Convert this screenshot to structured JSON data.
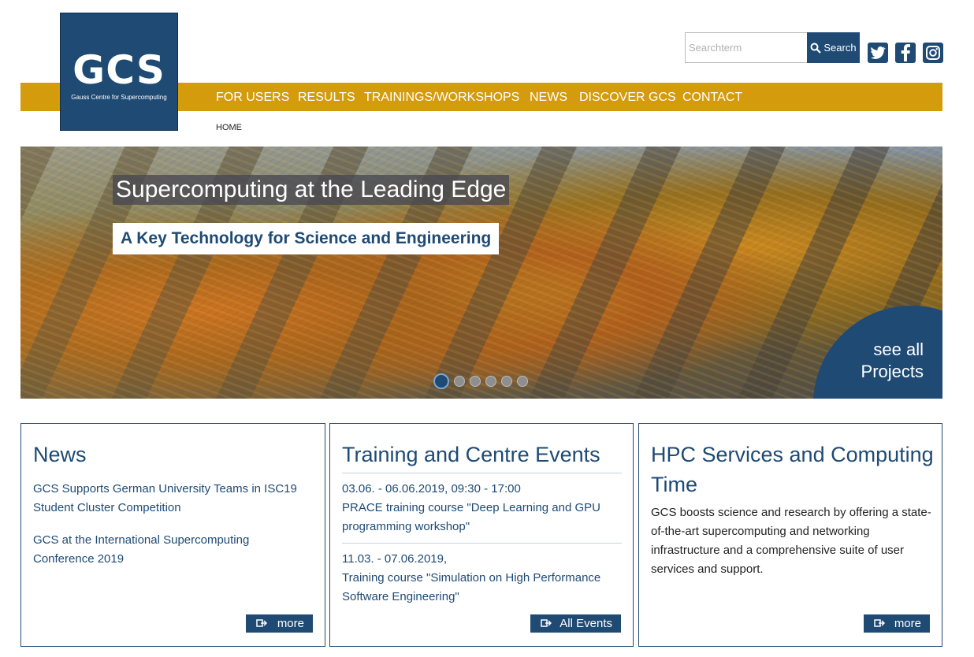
{
  "logo": {
    "text": "GCS",
    "subtitle": "Gauss Centre for Supercomputing"
  },
  "search": {
    "placeholder": "Searchterm",
    "button_label": "Search"
  },
  "social": [
    "twitter-icon",
    "facebook-icon",
    "instagram-icon"
  ],
  "nav": {
    "items": [
      "FOR USERS",
      "RESULTS",
      "TRAININGS/WORKSHOPS",
      "NEWS",
      "DISCOVER GCS",
      "CONTACT"
    ]
  },
  "breadcrumb": "HOME",
  "hero": {
    "title": "Supercomputing at the Leading Edge",
    "subtitle": "A Key Technology for Science and Engineering",
    "projects_line1": "see all",
    "projects_line2": "Projects",
    "slides": 6,
    "active_slide": 1
  },
  "news": {
    "heading": "News",
    "items": [
      "GCS Supports German University Teams in ISC19 Student Cluster Competition",
      "GCS at the International Supercomputing Conference 2019"
    ],
    "button": "more"
  },
  "events": {
    "heading": "Training and Centre Events",
    "items": [
      {
        "date": "03.06. - 06.06.2019, 09:30 - 17:00",
        "title": "PRACE training course \"Deep Learning and GPU programming workshop\""
      },
      {
        "date": "11.03. - 07.06.2019,",
        "title": "Training course \"Simulation on High Performance Software Engineering\""
      }
    ],
    "button": "All Events"
  },
  "services": {
    "heading": "HPC Services and Computing Time",
    "text": "GCS boosts science and research by offering a state-of-the-art supercomputing and networking infrastructure and a comprehensive suite of user services and support.",
    "button": "more"
  },
  "colors": {
    "brand": "#1e4a74",
    "nav": "#d49b0d"
  }
}
